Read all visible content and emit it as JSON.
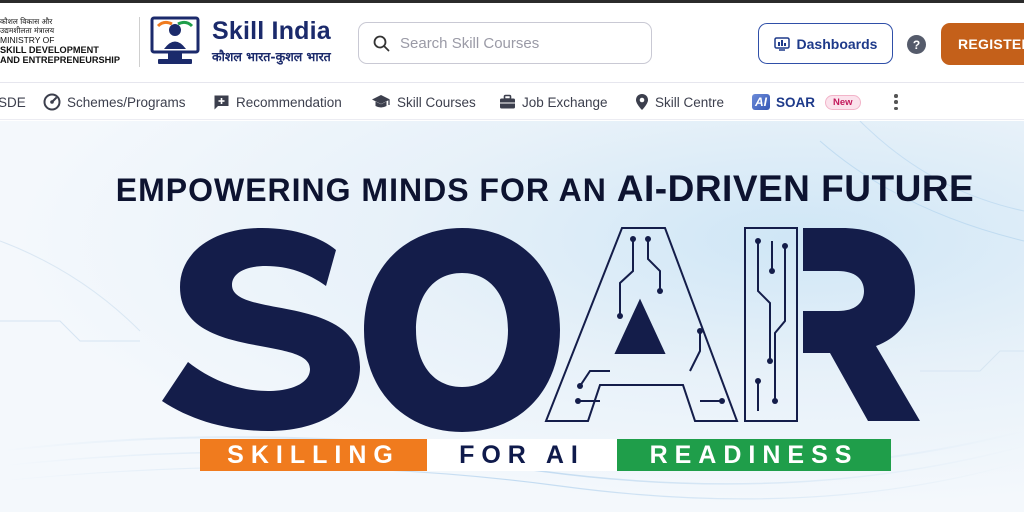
{
  "header": {
    "ministry_hindi_line1": "कौशल विकास और",
    "ministry_hindi_line2": "उद्यमशीलता मंत्रालय",
    "ministry_line1": "MINISTRY OF",
    "ministry_line2": "SKILL DEVELOPMENT",
    "ministry_line3": "AND ENTREPRENEURSHIP",
    "brand_title": "Skill India",
    "brand_tagline_hindi": "कौशल भारत-कुशल भारत",
    "search_placeholder": "Search Skill Courses",
    "dashboards_label": "Dashboards",
    "help_label": "?",
    "register_label": "REGISTER"
  },
  "nav": {
    "items": [
      {
        "label": "SDE"
      },
      {
        "label": "Schemes/Programs"
      },
      {
        "label": "Recommendation"
      },
      {
        "label": "Skill Courses"
      },
      {
        "label": "Job Exchange"
      },
      {
        "label": "Skill Centre"
      },
      {
        "label": "SOAR",
        "icon_text": "AI",
        "badge": "New"
      }
    ]
  },
  "hero": {
    "tagline_part1": "EMPOWERING MINDS FOR AN ",
    "tagline_part2": "AI-DRIVEN FUTURE",
    "title": "SOAR",
    "strip_1": "SKILLING",
    "strip_2": "FOR AI",
    "strip_3": "READINESS"
  },
  "colors": {
    "brand_navy": "#1b2a6b",
    "soar_navy": "#141d4a",
    "saffron": "#f07b1e",
    "green": "#1f9e4a",
    "register_orange": "#c4601a"
  }
}
